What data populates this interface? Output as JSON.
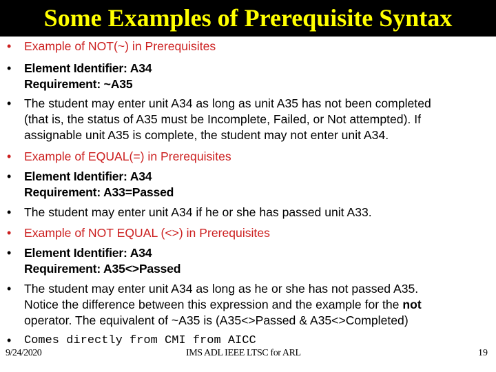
{
  "slide": {
    "title": "Some Examples of Prerequisite Syntax",
    "colors": {
      "title_bg": "#000000",
      "title_text": "#ffff00",
      "heading_red": "#cc1f1f",
      "body_text": "#000000"
    },
    "bullets": [
      {
        "style": "red",
        "lines": [
          "Example of NOT(~) in Prerequisites"
        ]
      },
      {
        "style": "bold",
        "lines": [
          "Element Identifier: A34",
          "Requirement: ~A35"
        ]
      },
      {
        "style": "normal",
        "lines": [
          "The student may enter unit A34 as long as unit A35 has not been completed",
          "(that is, the status of A35 must be Incomplete, Failed, or Not attempted).  If",
          "assignable unit A35 is complete, the student may not enter unit A34."
        ]
      },
      {
        "style": "red",
        "lines": [
          "Example of EQUAL(=) in Prerequisites"
        ]
      },
      {
        "style": "bold",
        "lines": [
          "Element Identifier: A34",
          "Requirement: A33=Passed"
        ]
      },
      {
        "style": "normal",
        "lines": [
          "The student may enter unit A34 if he or she has passed unit A33."
        ]
      },
      {
        "style": "red",
        "lines": [
          "Example of NOT EQUAL (<>) in Prerequisites"
        ]
      },
      {
        "style": "bold",
        "lines": [
          "Element Identifier: A34",
          "Requirement: A35<>Passed"
        ]
      },
      {
        "style": "normal",
        "lines": [
          "The student may enter unit A34 as long as he or she has not passed A35.",
          "Notice the difference between this expression and the example for the ",
          "operator.  The equivalent of ~A35 is (A35<>Passed & A35<>Completed)"
        ],
        "emphasis_word": "not"
      },
      {
        "style": "mono",
        "lines": [
          "Comes directly from CMI from AICC"
        ]
      }
    ],
    "bullet_glyph": "•",
    "footer": {
      "date": "9/24/2020",
      "center": "IMS ADL IEEE LTSC for ARL",
      "page_number": "19"
    }
  }
}
